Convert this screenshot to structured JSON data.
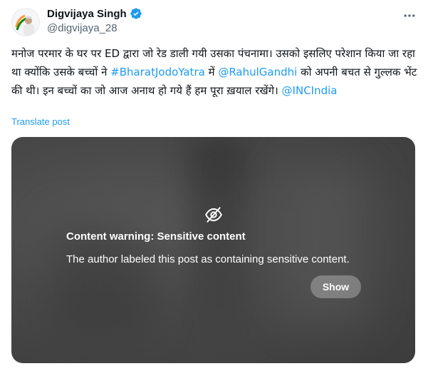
{
  "author": {
    "display_name": "Digvijaya Singh",
    "handle": "@digvijaya_28",
    "avatar_icon": "profile-avatar",
    "verified_icon": "verified-badge-icon",
    "verified_color": "#1d9bf0"
  },
  "more_icon": "more-options-icon",
  "tweet": {
    "part1": "मनोज परमार के घर पर ED द्वारा जो रेड डाली गयी उसका पंचनामा। उसको इसलिए परेशान किया जा रहा था क्योंकि उसके बच्चों ने ",
    "hashtag": "#BharatJodoYatra",
    "part2": " में ",
    "mention1": "@RahulGandhi",
    "part3": " को अपनी बचत से गुल्लक भेंट की थी। इन बच्चों का जो आज अनाथ हो गये हैं हम पूरा ख़याल रखेंगे। ",
    "mention2": "@INCIndia"
  },
  "translate_label": "Translate post",
  "content_warning": {
    "icon": "eye-off-icon",
    "title": "Content warning: Sensitive content",
    "description": "The author labeled this post as containing sensitive content.",
    "show_label": "Show"
  },
  "colors": {
    "link": "#1d9bf0",
    "text": "#0f1419",
    "secondary": "#536471"
  }
}
